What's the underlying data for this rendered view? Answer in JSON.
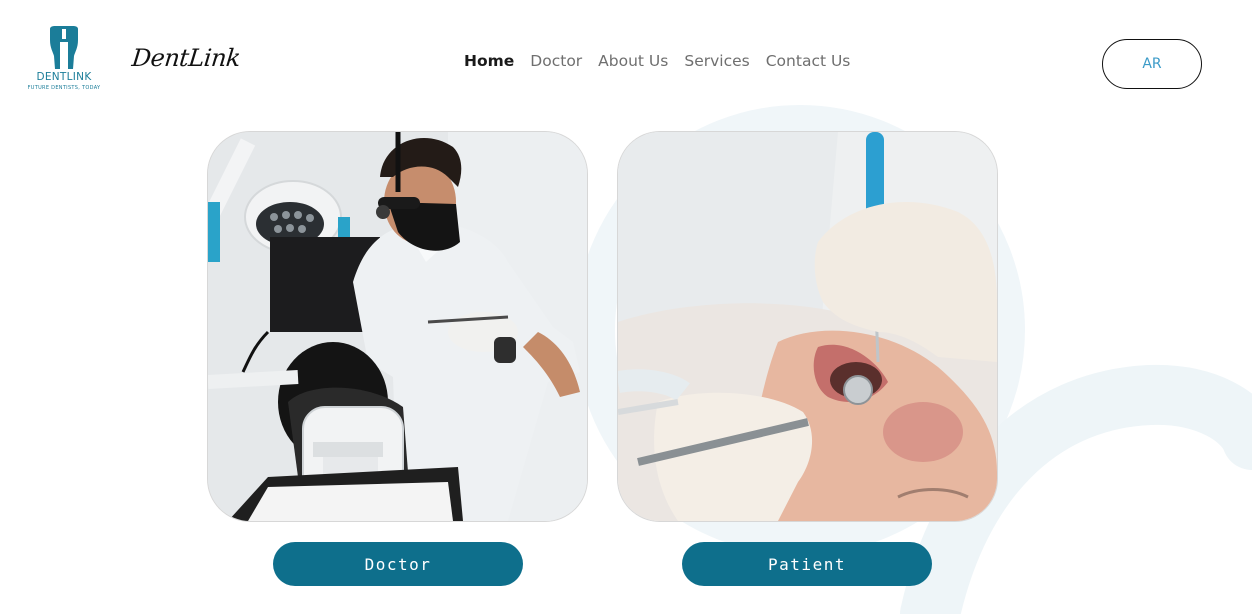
{
  "header": {
    "logo": {
      "name": "DENTLINK",
      "tagline": "FUTURE DENTISTS, TODAY",
      "icon": "tooth-icon"
    },
    "brand_name": "DentLink",
    "nav": [
      {
        "label": "Home",
        "active": true
      },
      {
        "label": "Doctor",
        "active": false
      },
      {
        "label": "About Us",
        "active": false
      },
      {
        "label": "Services",
        "active": false
      },
      {
        "label": "Contact Us",
        "active": false
      }
    ],
    "language_button": "AR"
  },
  "cards": [
    {
      "image": "dentist-examining-patient-photo",
      "button_label": "Doctor"
    },
    {
      "image": "patient-receiving-dental-treatment-photo",
      "button_label": "Patient"
    }
  ],
  "colors": {
    "primary": "#0e6f8c",
    "logo": "#1b7d99",
    "language_text": "#3c9bc8",
    "background_swirl": "#eef5f8"
  }
}
